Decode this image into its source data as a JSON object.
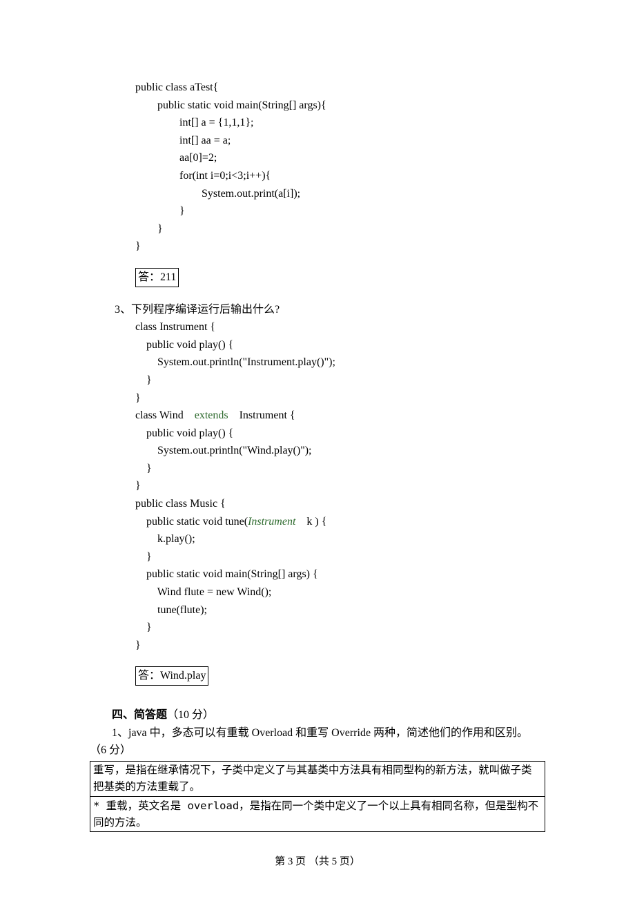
{
  "code1": {
    "l1": "public class aTest{",
    "l2": "        public static void main(String[] args){",
    "l3": "                int[] a = {1,1,1};",
    "l4": "                int[] aa = a;",
    "l5": "                aa[0]=2;",
    "l6": "                for(int i=0;i<3;i++){",
    "l7": "                        System.out.print(a[i]);",
    "l8": "                }",
    "l9": "        }",
    "l10": "}"
  },
  "ans1": "答：211",
  "q3": {
    "prompt": "3、下列程序编译运行后输出什么?",
    "l1": "class Instrument {",
    "l2": "    public void play() {",
    "l3": "        System.out.println(\"Instrument.play()\");",
    "l4": "    }",
    "l5": "}",
    "l6_a": "class Wind    ",
    "l6_b": "extends",
    "l6_c": "    Instrument {",
    "l7": "    public void play() {",
    "l8": "        System.out.println(\"Wind.play()\");",
    "l9": "    }",
    "l10": "}",
    "l11": "public class Music {",
    "l12_a": "    public static void tune(",
    "l12_b": "Instrument",
    "l12_c": "    k ) {",
    "l13": "        k.play();",
    "l14": "    }",
    "l15": "    public static void main(String[] args) {",
    "l16": "        Wind flute = new Wind();",
    "l17": "        tune(flute);",
    "l18": "    }",
    "l19": "}"
  },
  "ans2": "答：Wind.play",
  "section4": {
    "title_a": "四、简答题",
    "title_b": "（10 分）",
    "q1": "1、java 中，多态可以有重载 Overload 和重写 Override 两种，简述他们的作用和区别。",
    "q1_b": "（6 分）",
    "a_row1": "  重写，是指在继承情况下，子类中定义了与其基类中方法具有相同型构的新方法，就叫做子类把基类的方法重载了。",
    "a_row2": "* 重载，英文名是 overload，是指在同一个类中定义了一个以上具有相同名称，但是型构不同的方法。"
  },
  "footer": "第  3  页  （共  5  页）"
}
